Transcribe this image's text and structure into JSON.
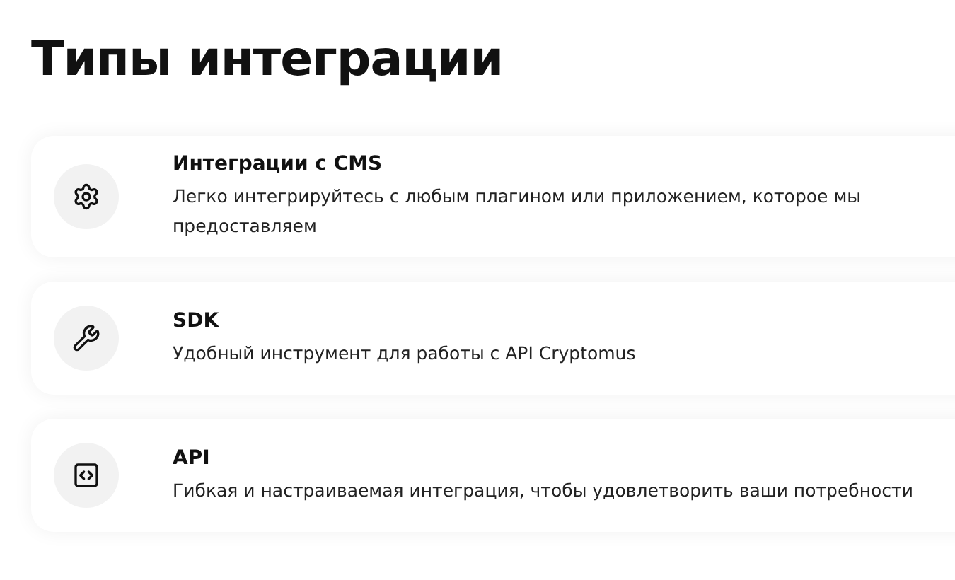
{
  "heading": "Типы интеграции",
  "cards": [
    {
      "kind": "cms",
      "title": "Интеграции с CMS",
      "description": "Легко интегрируйтесь с любым плагином или приложением, которое мы предоставляем"
    },
    {
      "kind": "sdk",
      "title": "SDK",
      "description": "Удобный инструмент для работы с API Cryptomus"
    },
    {
      "kind": "api",
      "title": "API",
      "description": "Гибкая и настраиваемая интеграция, чтобы удовлетворить ваши потребности"
    }
  ]
}
